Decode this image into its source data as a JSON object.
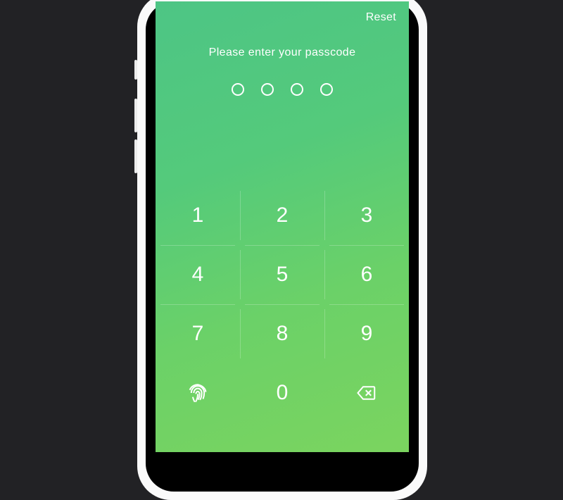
{
  "header": {
    "reset_label": "Reset"
  },
  "prompt": "Please enter your passcode",
  "passcode": {
    "length": 4,
    "entered": 0
  },
  "keypad": {
    "rows": [
      [
        "1",
        "2",
        "3"
      ],
      [
        "4",
        "5",
        "6"
      ],
      [
        "7",
        "8",
        "9"
      ]
    ],
    "zero": "0",
    "fingerprint_icon": "fingerprint-icon",
    "backspace_icon": "backspace-icon"
  },
  "colors": {
    "gradient_start": "#4dc585",
    "gradient_end": "#7bd45f",
    "text": "#ffffff",
    "page_bg": "#222225"
  }
}
